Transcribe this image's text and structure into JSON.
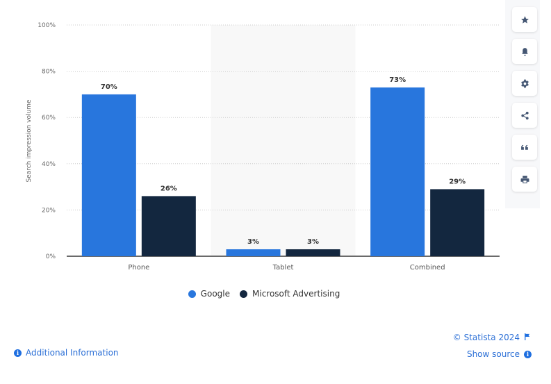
{
  "chart_data": {
    "type": "bar",
    "title": "",
    "xlabel": "",
    "ylabel": "Search impression volume",
    "ylim": [
      0,
      100
    ],
    "yticks": [
      0,
      20,
      40,
      60,
      80,
      100
    ],
    "ytick_labels": [
      "0%",
      "20%",
      "40%",
      "60%",
      "80%",
      "100%"
    ],
    "categories": [
      "Phone",
      "Tablet",
      "Combined"
    ],
    "highlighted_category": "Tablet",
    "grid": true,
    "legend_position": "bottom-center",
    "series": [
      {
        "name": "Google",
        "color": "#2876dd",
        "values": [
          70,
          3,
          73
        ],
        "labels": [
          "70%",
          "3%",
          "73%"
        ]
      },
      {
        "name": "Microsoft Advertising",
        "color": "#13273f",
        "values": [
          26,
          3,
          29
        ],
        "labels": [
          "26%",
          "3%",
          "29%"
        ]
      }
    ]
  },
  "sidebar": {
    "buttons": [
      {
        "name": "favorite",
        "icon": "star-icon"
      },
      {
        "name": "notification",
        "icon": "bell-icon"
      },
      {
        "name": "settings",
        "icon": "gear-icon"
      },
      {
        "name": "share",
        "icon": "share-icon"
      },
      {
        "name": "cite",
        "icon": "quote-icon"
      },
      {
        "name": "print",
        "icon": "print-icon"
      }
    ]
  },
  "footer": {
    "additional_info": "Additional Information",
    "copyright": "© Statista 2024",
    "show_source": "Show source"
  }
}
